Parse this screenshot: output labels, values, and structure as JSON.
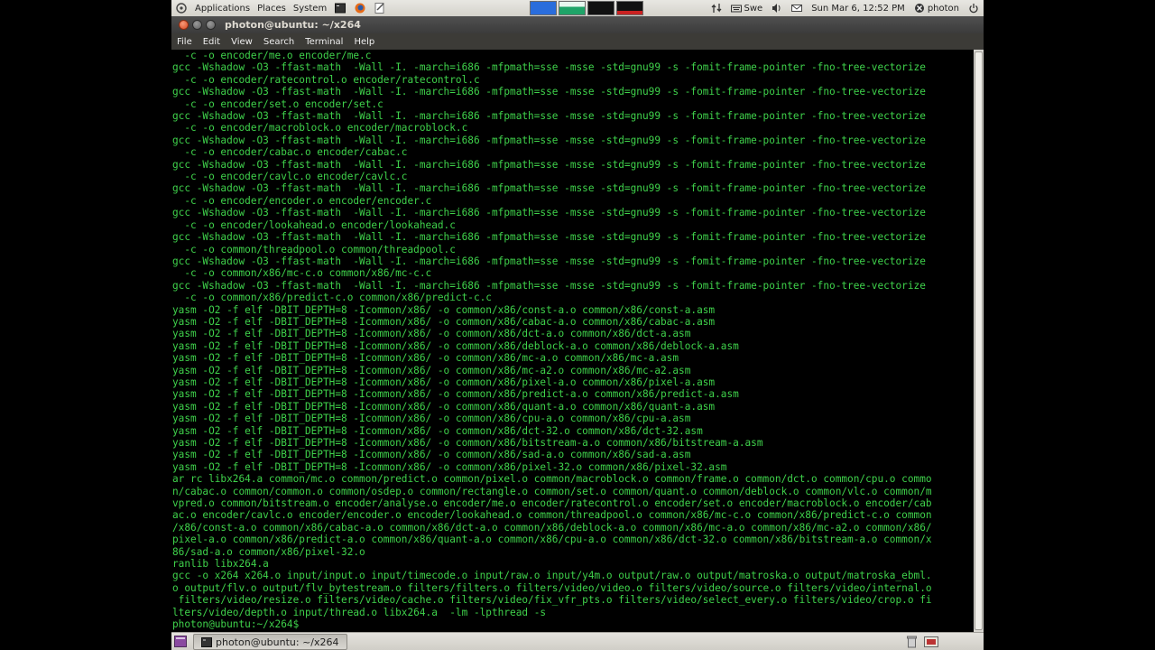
{
  "top_panel": {
    "menus": [
      "Applications",
      "Places",
      "System"
    ],
    "keyboard_layout": "Swe",
    "clock": "Sun Mar  6, 12:52 PM",
    "user": "photon",
    "workspace_colors": [
      "#2a6ddc",
      "#1fa468",
      "#1a1a1a",
      "#1a1a1a",
      "#c92222"
    ]
  },
  "window": {
    "title": "photon@ubuntu: ~/x264",
    "menus": [
      "File",
      "Edit",
      "View",
      "Search",
      "Terminal",
      "Help"
    ]
  },
  "terminal": {
    "fg_color": "#3fd24b",
    "bg_color": "#000000",
    "lines": [
      "  -c -o encoder/me.o encoder/me.c",
      "gcc -Wshadow -O3 -ffast-math  -Wall -I. -march=i686 -mfpmath=sse -msse -std=gnu99 -s -fomit-frame-pointer -fno-tree-vectorize",
      "  -c -o encoder/ratecontrol.o encoder/ratecontrol.c",
      "gcc -Wshadow -O3 -ffast-math  -Wall -I. -march=i686 -mfpmath=sse -msse -std=gnu99 -s -fomit-frame-pointer -fno-tree-vectorize",
      "  -c -o encoder/set.o encoder/set.c",
      "gcc -Wshadow -O3 -ffast-math  -Wall -I. -march=i686 -mfpmath=sse -msse -std=gnu99 -s -fomit-frame-pointer -fno-tree-vectorize",
      "  -c -o encoder/macroblock.o encoder/macroblock.c",
      "gcc -Wshadow -O3 -ffast-math  -Wall -I. -march=i686 -mfpmath=sse -msse -std=gnu99 -s -fomit-frame-pointer -fno-tree-vectorize",
      "  -c -o encoder/cabac.o encoder/cabac.c",
      "gcc -Wshadow -O3 -ffast-math  -Wall -I. -march=i686 -mfpmath=sse -msse -std=gnu99 -s -fomit-frame-pointer -fno-tree-vectorize",
      "  -c -o encoder/cavlc.o encoder/cavlc.c",
      "gcc -Wshadow -O3 -ffast-math  -Wall -I. -march=i686 -mfpmath=sse -msse -std=gnu99 -s -fomit-frame-pointer -fno-tree-vectorize",
      "  -c -o encoder/encoder.o encoder/encoder.c",
      "gcc -Wshadow -O3 -ffast-math  -Wall -I. -march=i686 -mfpmath=sse -msse -std=gnu99 -s -fomit-frame-pointer -fno-tree-vectorize",
      "  -c -o encoder/lookahead.o encoder/lookahead.c",
      "gcc -Wshadow -O3 -ffast-math  -Wall -I. -march=i686 -mfpmath=sse -msse -std=gnu99 -s -fomit-frame-pointer -fno-tree-vectorize",
      "  -c -o common/threadpool.o common/threadpool.c",
      "gcc -Wshadow -O3 -ffast-math  -Wall -I. -march=i686 -mfpmath=sse -msse -std=gnu99 -s -fomit-frame-pointer -fno-tree-vectorize",
      "  -c -o common/x86/mc-c.o common/x86/mc-c.c",
      "gcc -Wshadow -O3 -ffast-math  -Wall -I. -march=i686 -mfpmath=sse -msse -std=gnu99 -s -fomit-frame-pointer -fno-tree-vectorize",
      "  -c -o common/x86/predict-c.o common/x86/predict-c.c",
      "yasm -O2 -f elf -DBIT_DEPTH=8 -Icommon/x86/ -o common/x86/const-a.o common/x86/const-a.asm",
      "yasm -O2 -f elf -DBIT_DEPTH=8 -Icommon/x86/ -o common/x86/cabac-a.o common/x86/cabac-a.asm",
      "yasm -O2 -f elf -DBIT_DEPTH=8 -Icommon/x86/ -o common/x86/dct-a.o common/x86/dct-a.asm",
      "yasm -O2 -f elf -DBIT_DEPTH=8 -Icommon/x86/ -o common/x86/deblock-a.o common/x86/deblock-a.asm",
      "yasm -O2 -f elf -DBIT_DEPTH=8 -Icommon/x86/ -o common/x86/mc-a.o common/x86/mc-a.asm",
      "yasm -O2 -f elf -DBIT_DEPTH=8 -Icommon/x86/ -o common/x86/mc-a2.o common/x86/mc-a2.asm",
      "yasm -O2 -f elf -DBIT_DEPTH=8 -Icommon/x86/ -o common/x86/pixel-a.o common/x86/pixel-a.asm",
      "yasm -O2 -f elf -DBIT_DEPTH=8 -Icommon/x86/ -o common/x86/predict-a.o common/x86/predict-a.asm",
      "yasm -O2 -f elf -DBIT_DEPTH=8 -Icommon/x86/ -o common/x86/quant-a.o common/x86/quant-a.asm",
      "yasm -O2 -f elf -DBIT_DEPTH=8 -Icommon/x86/ -o common/x86/cpu-a.o common/x86/cpu-a.asm",
      "yasm -O2 -f elf -DBIT_DEPTH=8 -Icommon/x86/ -o common/x86/dct-32.o common/x86/dct-32.asm",
      "yasm -O2 -f elf -DBIT_DEPTH=8 -Icommon/x86/ -o common/x86/bitstream-a.o common/x86/bitstream-a.asm",
      "yasm -O2 -f elf -DBIT_DEPTH=8 -Icommon/x86/ -o common/x86/sad-a.o common/x86/sad-a.asm",
      "yasm -O2 -f elf -DBIT_DEPTH=8 -Icommon/x86/ -o common/x86/pixel-32.o common/x86/pixel-32.asm",
      "ar rc libx264.a common/mc.o common/predict.o common/pixel.o common/macroblock.o common/frame.o common/dct.o common/cpu.o commo",
      "n/cabac.o common/common.o common/osdep.o common/rectangle.o common/set.o common/quant.o common/deblock.o common/vlc.o common/m",
      "vpred.o common/bitstream.o encoder/analyse.o encoder/me.o encoder/ratecontrol.o encoder/set.o encoder/macroblock.o encoder/cab",
      "ac.o encoder/cavlc.o encoder/encoder.o encoder/lookahead.o common/threadpool.o common/x86/mc-c.o common/x86/predict-c.o common",
      "/x86/const-a.o common/x86/cabac-a.o common/x86/dct-a.o common/x86/deblock-a.o common/x86/mc-a.o common/x86/mc-a2.o common/x86/",
      "pixel-a.o common/x86/predict-a.o common/x86/quant-a.o common/x86/cpu-a.o common/x86/dct-32.o common/x86/bitstream-a.o common/x",
      "86/sad-a.o common/x86/pixel-32.o",
      "ranlib libx264.a",
      "gcc -o x264 x264.o input/input.o input/timecode.o input/raw.o input/y4m.o output/raw.o output/matroska.o output/matroska_ebml.",
      "o output/flv.o output/flv_bytestream.o filters/filters.o filters/video/video.o filters/video/source.o filters/video/internal.o",
      " filters/video/resize.o filters/video/cache.o filters/video/fix_vfr_pts.o filters/video/select_every.o filters/video/crop.o fi",
      "lters/video/depth.o input/thread.o libx264.a  -lm -lpthread -s",
      "photon@ubuntu:~/x264$"
    ]
  },
  "taskbar": {
    "task_label": "photon@ubuntu: ~/x264"
  }
}
